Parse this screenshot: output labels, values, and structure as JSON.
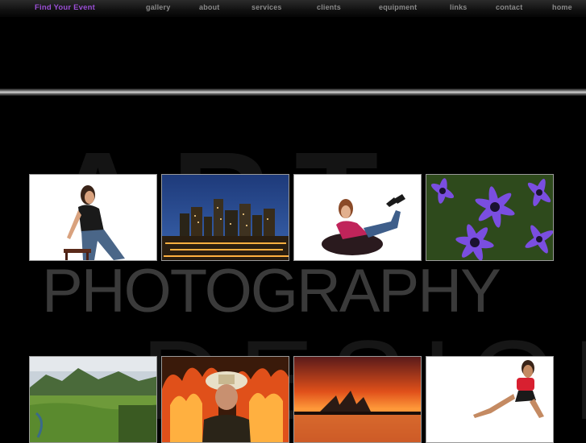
{
  "nav": {
    "find_event": "Find Your Event",
    "gallery": "gallery",
    "about": "about",
    "services": "services",
    "clients": "clients",
    "equipment": "equipment",
    "links": "links",
    "contact": "contact",
    "home": "home"
  },
  "watermark": {
    "art": "ART",
    "photography": "PHOTOGRAPHY",
    "design": "DESIGN"
  },
  "colors": {
    "background": "#000000",
    "nav_text": "#8a8a8a",
    "find_event": "#9b4fd6",
    "thumb_border": "#9a9a9a"
  }
}
